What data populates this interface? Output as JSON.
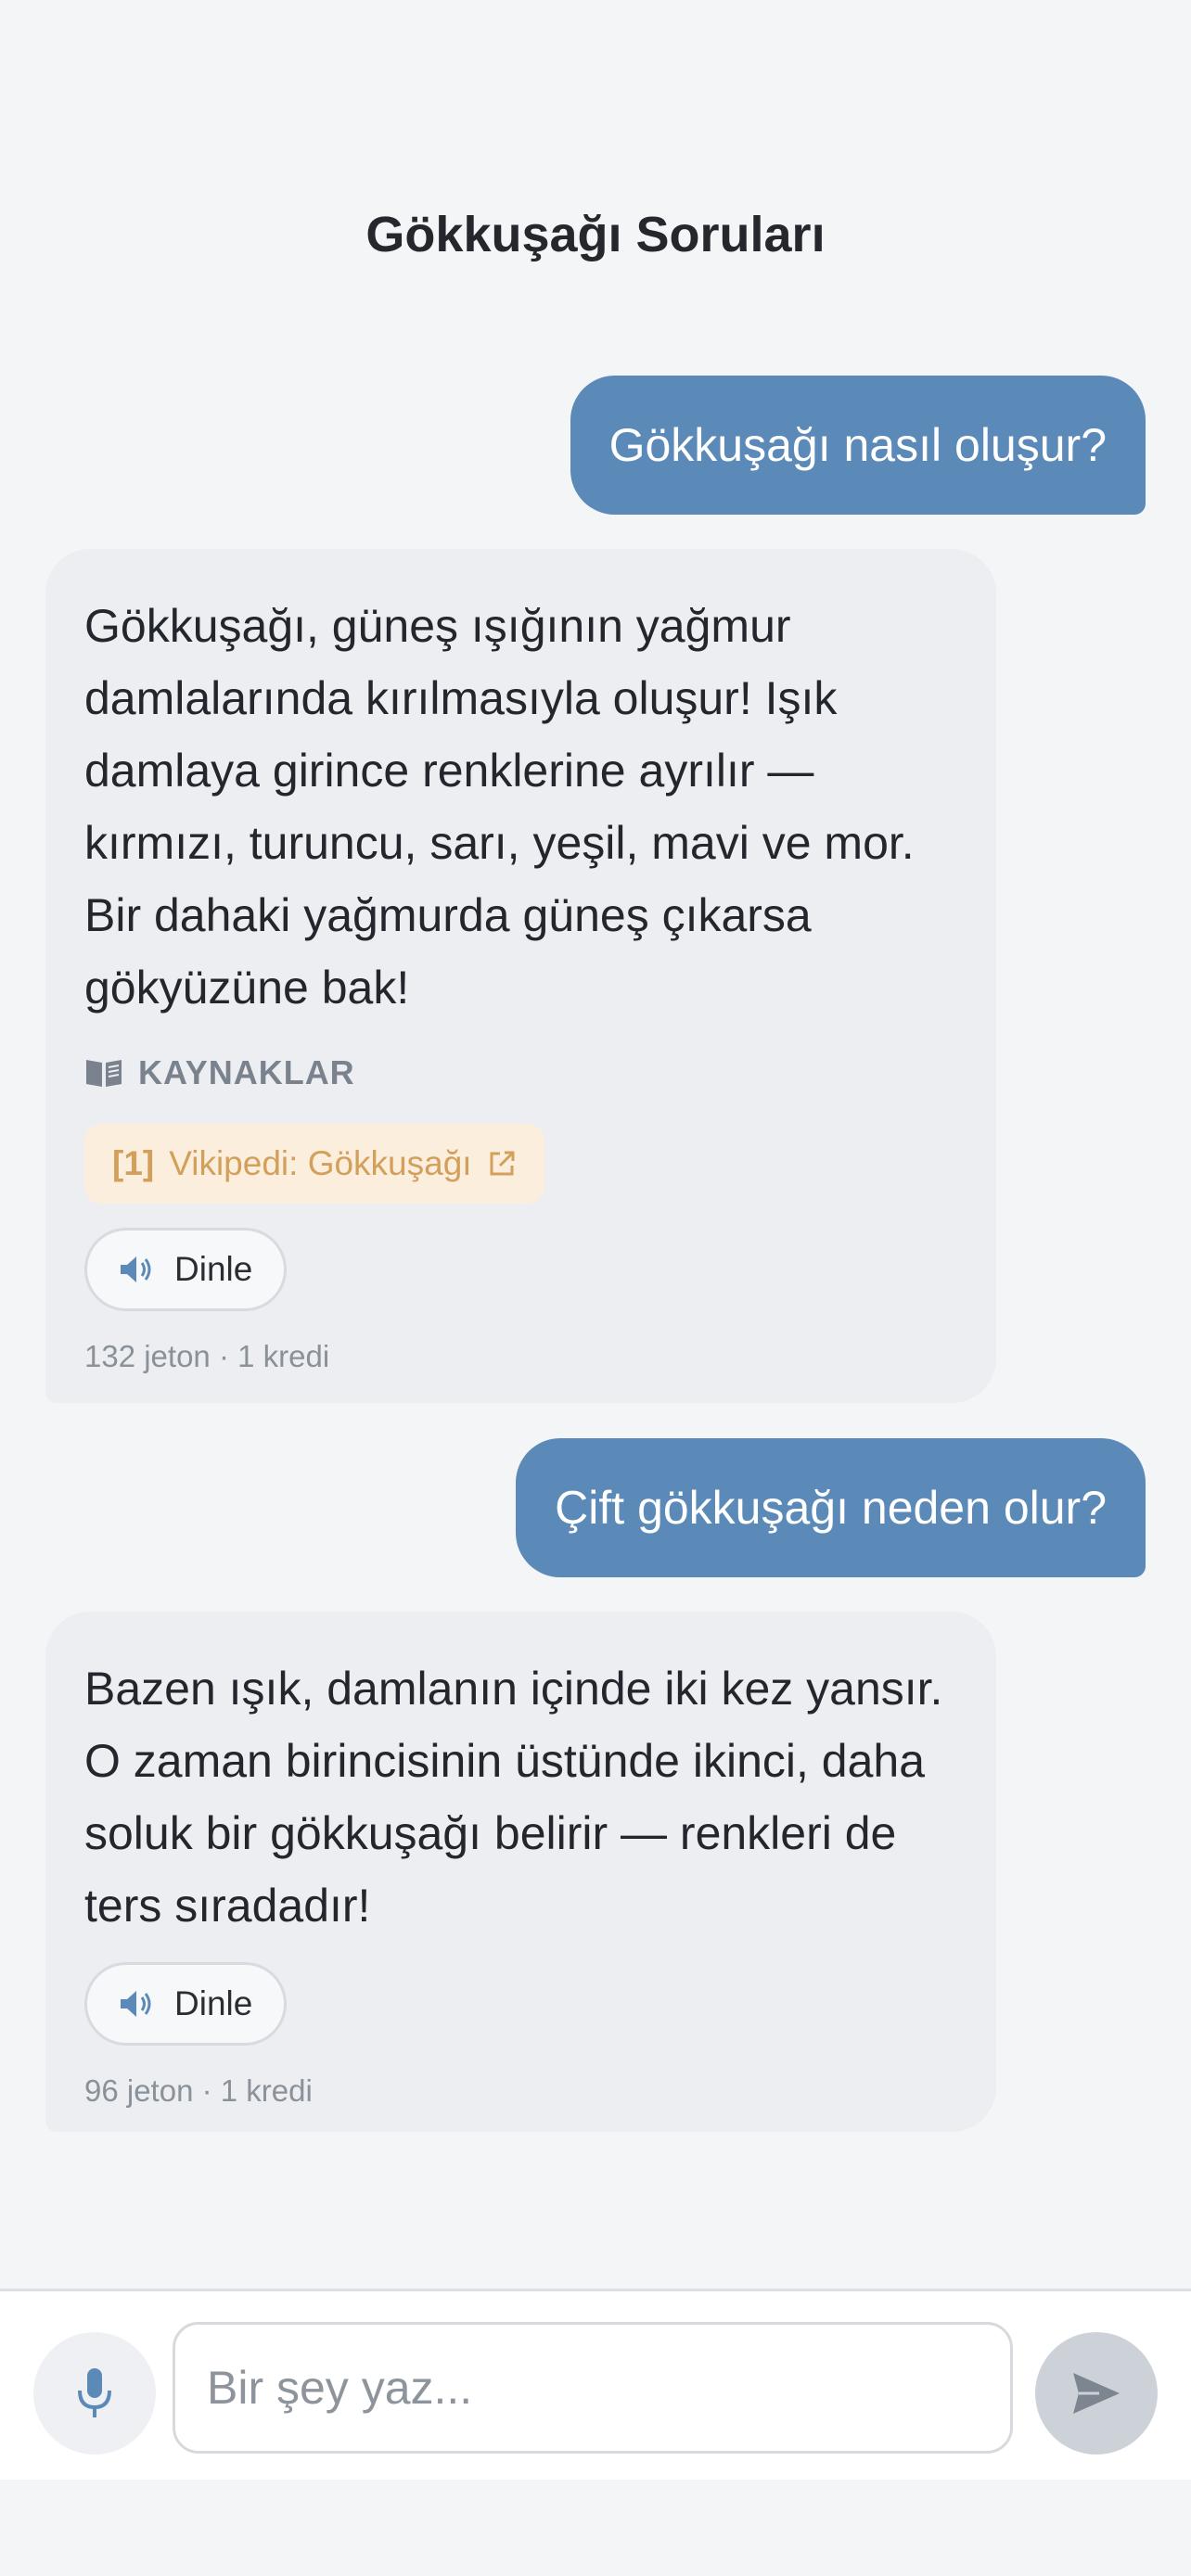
{
  "header": {
    "title": "Gökkuşağı Soruları"
  },
  "messages": [
    {
      "role": "user",
      "text": "Gökkuşağı nasıl oluşur?"
    },
    {
      "role": "assistant",
      "text": "Gökkuşağı, güneş ışığının yağmur damlalarında kırılmasıyla oluşur! Işık damlaya girince renklerine ayrılır — kırmızı, turuncu, sarı, yeşil, mavi ve mor. Bir dahaki yağmurda güneş çıkarsa gökyüzüne bak!",
      "sources_label": "KAYNAKLAR",
      "sources": [
        {
          "index": "[1]",
          "title": "Vikipedi: Gökkuşağı"
        }
      ],
      "listen_label": "Dinle",
      "meta": "132 jeton · 1 kredi"
    },
    {
      "role": "user",
      "text": "Çift gökkuşağı neden olur?"
    },
    {
      "role": "assistant",
      "text": "Bazen ışık, damlanın içinde iki kez yansır. O zaman birincisinin üstünde ikinci, daha soluk bir gökkuşağı belirir — renkleri de ters sıradadır!",
      "listen_label": "Dinle",
      "meta": "96 jeton · 1 kredi"
    }
  ],
  "composer": {
    "placeholder": "Bir şey yaz...",
    "mic_icon": "microphone-icon",
    "send_icon": "send-icon"
  },
  "colors": {
    "user_bubble": "#5b8ab9",
    "assistant_bubble": "#eceef2",
    "source_chip_bg": "#fbeedd",
    "source_chip_text": "#d3a05c"
  }
}
